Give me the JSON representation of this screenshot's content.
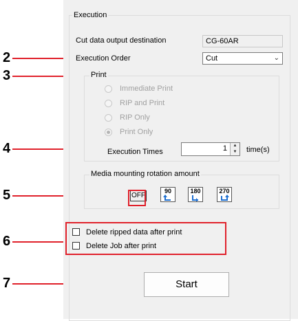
{
  "execution": {
    "group_label": "Execution",
    "cut_data_label": "Cut data output destination",
    "cut_data_value": "CG-60AR",
    "execution_order_label": "Execution Order",
    "execution_order_value": "Cut",
    "print": {
      "group_label": "Print",
      "options": [
        {
          "label": "Immediate Print",
          "selected": false
        },
        {
          "label": "RIP and Print",
          "selected": false
        },
        {
          "label": "RIP Only",
          "selected": false
        },
        {
          "label": "Print Only",
          "selected": true
        }
      ],
      "execution_times_label": "Execution Times",
      "execution_times_value": "1",
      "execution_times_unit": "time(s)"
    },
    "rotation": {
      "group_label": "Media mounting rotation amount",
      "off_label": "OFF",
      "angles": [
        "90",
        "180",
        "270"
      ]
    },
    "delete_ripped_label": "Delete ripped data after print",
    "delete_job_label": "Delete Job after print",
    "start_label": "Start"
  },
  "callouts": [
    "2",
    "3",
    "4",
    "5",
    "6",
    "7"
  ],
  "colors": {
    "callout": "#e0202a",
    "rotate_arrow": "#1e6fd0"
  }
}
